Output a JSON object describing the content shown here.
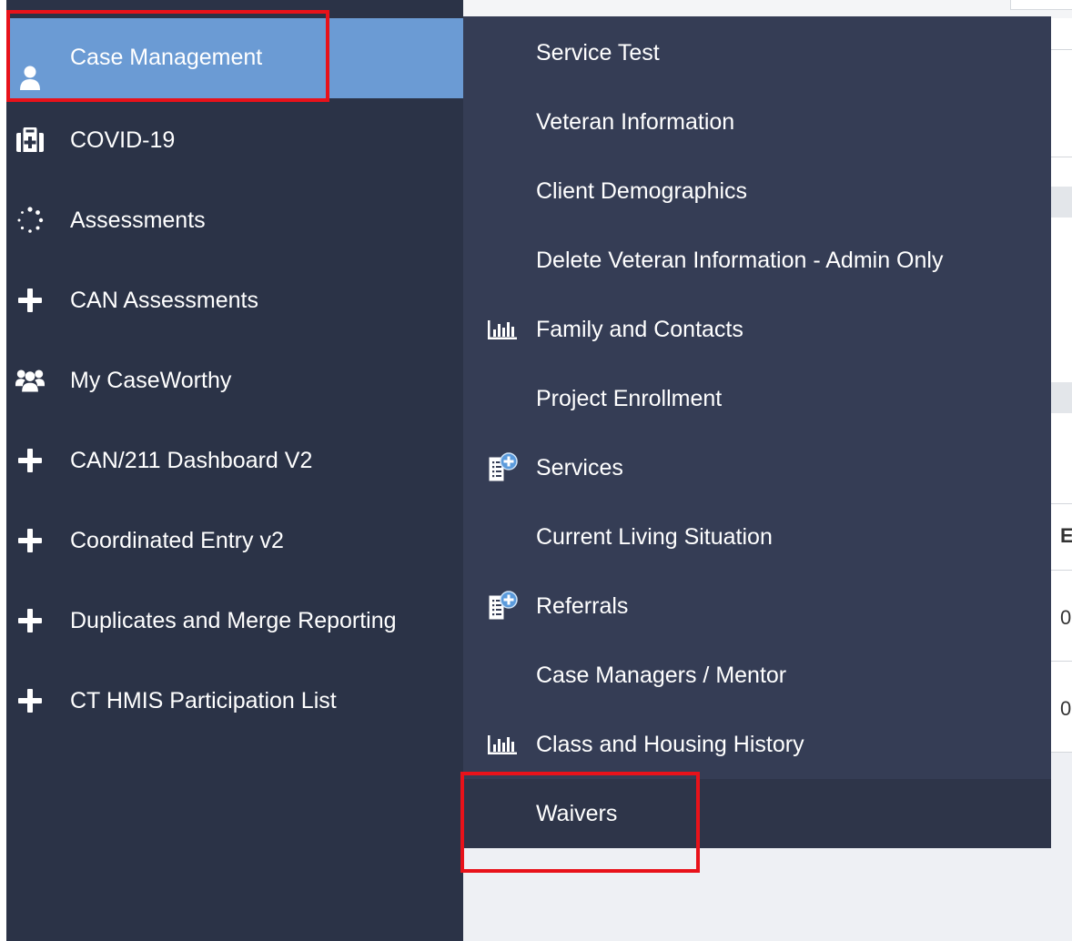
{
  "sidebar": {
    "items": [
      {
        "label": "Case Management",
        "icon": "user-icon",
        "active": true
      },
      {
        "label": "COVID-19",
        "icon": "medkit-icon",
        "active": false
      },
      {
        "label": "Assessments",
        "icon": "spinner-icon",
        "active": false
      },
      {
        "label": "CAN Assessments",
        "icon": "plus-icon",
        "active": false
      },
      {
        "label": "My CaseWorthy",
        "icon": "users-icon",
        "active": false
      },
      {
        "label": "CAN/211 Dashboard V2",
        "icon": "plus-icon",
        "active": false
      },
      {
        "label": "Coordinated Entry v2",
        "icon": "plus-icon",
        "active": false
      },
      {
        "label": "Duplicates and Merge Reporting",
        "icon": "plus-icon",
        "active": false
      },
      {
        "label": "CT HMIS Participation List",
        "icon": "plus-icon",
        "active": false
      }
    ]
  },
  "flyout": {
    "items": [
      {
        "label": "Service Test",
        "icon": null
      },
      {
        "label": "Veteran Information",
        "icon": null
      },
      {
        "label": "Client Demographics",
        "icon": null
      },
      {
        "label": "Delete Veteran Information - Admin Only",
        "icon": null
      },
      {
        "label": "Family and Contacts",
        "icon": "bar-chart-icon"
      },
      {
        "label": "Project Enrollment",
        "icon": null
      },
      {
        "label": "Services",
        "icon": "add-document-icon"
      },
      {
        "label": "Current Living Situation",
        "icon": null
      },
      {
        "label": "Referrals",
        "icon": "add-document-icon"
      },
      {
        "label": "Case Managers / Mentor",
        "icon": null
      },
      {
        "label": "Class and Housing History",
        "icon": "bar-chart-icon"
      },
      {
        "label": "Waivers",
        "icon": null
      }
    ]
  },
  "background": {
    "header_char": "E",
    "row_values": [
      "0",
      "0"
    ]
  },
  "colors": {
    "sidebar_bg": "#2b3347",
    "active_bg": "#6b9bd4",
    "flyout_bg": "#353d55",
    "highlight": "#e8121a"
  }
}
